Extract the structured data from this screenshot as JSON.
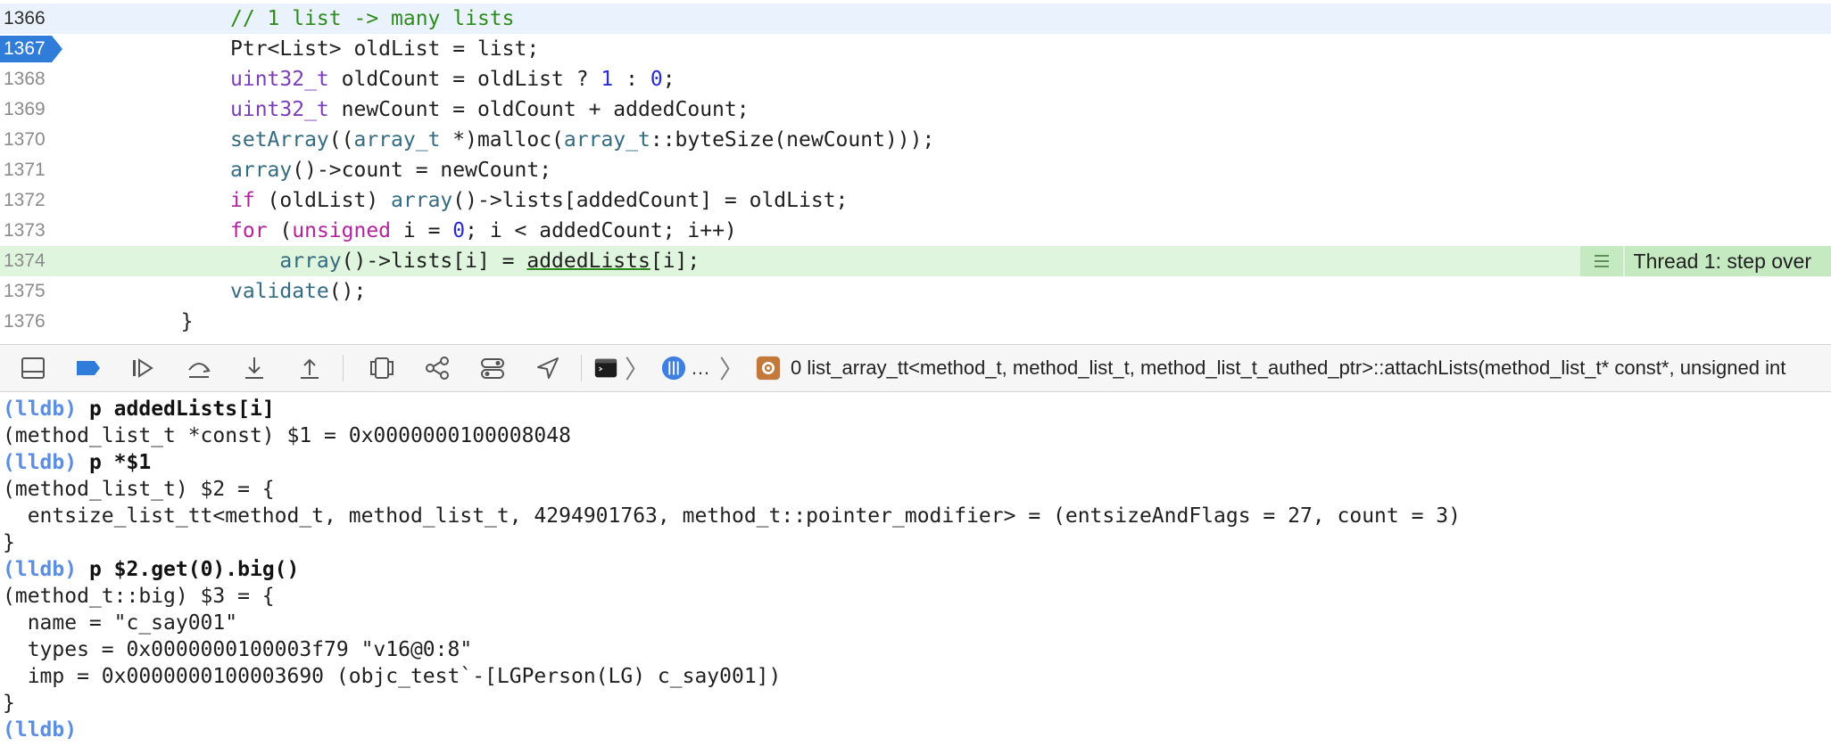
{
  "editor": {
    "lines": [
      {
        "num": "1366",
        "state": "current",
        "indent": 10,
        "tokens": [
          {
            "t": "// 1 list -> many lists",
            "c": "cm"
          }
        ]
      },
      {
        "num": "1367",
        "state": "pc",
        "indent": 10,
        "tokens": [
          {
            "t": "Ptr<List> oldList = list;",
            "c": ""
          }
        ]
      },
      {
        "num": "1368",
        "state": "",
        "indent": 10,
        "tokens": [
          {
            "t": "uint32_t",
            "c": "ty"
          },
          {
            "t": " oldCount = oldList ? ",
            "c": ""
          },
          {
            "t": "1",
            "c": "num"
          },
          {
            "t": " : ",
            "c": ""
          },
          {
            "t": "0",
            "c": "num"
          },
          {
            "t": ";",
            "c": ""
          }
        ]
      },
      {
        "num": "1369",
        "state": "",
        "indent": 10,
        "tokens": [
          {
            "t": "uint32_t",
            "c": "ty"
          },
          {
            "t": " newCount = oldCount + addedCount;",
            "c": ""
          }
        ]
      },
      {
        "num": "1370",
        "state": "",
        "indent": 10,
        "tokens": [
          {
            "t": "setArray",
            "c": "fn"
          },
          {
            "t": "((",
            "c": ""
          },
          {
            "t": "array_t",
            "c": "fn"
          },
          {
            "t": " *)malloc(",
            "c": ""
          },
          {
            "t": "array_t",
            "c": "fn"
          },
          {
            "t": "::byteSize(newCount)));",
            "c": ""
          }
        ]
      },
      {
        "num": "1371",
        "state": "",
        "indent": 10,
        "tokens": [
          {
            "t": "array",
            "c": "fn"
          },
          {
            "t": "()->count = newCount;",
            "c": ""
          }
        ]
      },
      {
        "num": "1372",
        "state": "",
        "indent": 10,
        "tokens": [
          {
            "t": "if",
            "c": "kw"
          },
          {
            "t": " (oldList) ",
            "c": ""
          },
          {
            "t": "array",
            "c": "fn"
          },
          {
            "t": "()->lists[addedCount] = oldList;",
            "c": ""
          }
        ]
      },
      {
        "num": "1373",
        "state": "",
        "indent": 10,
        "tokens": [
          {
            "t": "for",
            "c": "kw"
          },
          {
            "t": " (",
            "c": ""
          },
          {
            "t": "unsigned",
            "c": "kw"
          },
          {
            "t": " i = ",
            "c": ""
          },
          {
            "t": "0",
            "c": "num"
          },
          {
            "t": "; i < addedCount; i++)",
            "c": ""
          }
        ]
      },
      {
        "num": "1374",
        "state": "stepped",
        "indent": 14,
        "tokens": [
          {
            "t": "array",
            "c": "fn"
          },
          {
            "t": "()->lists[i] = ",
            "c": ""
          },
          {
            "t": "addedLists",
            "c": "ul"
          },
          {
            "t": "[i];",
            "c": ""
          }
        ]
      },
      {
        "num": "1375",
        "state": "",
        "indent": 10,
        "tokens": [
          {
            "t": "validate",
            "c": "fn"
          },
          {
            "t": "();",
            "c": ""
          }
        ]
      },
      {
        "num": "1376",
        "state": "",
        "indent": 6,
        "tokens": [
          {
            "t": "}",
            "c": ""
          }
        ]
      }
    ],
    "annotation": {
      "text": "Thread 1: step over",
      "line": "1374"
    }
  },
  "debugbar": {
    "buttons": [
      {
        "name": "hide-debug-area-icon"
      },
      {
        "name": "breakpoints-toggle-icon"
      },
      {
        "name": "continue-icon"
      },
      {
        "name": "step-over-icon"
      },
      {
        "name": "step-into-icon"
      },
      {
        "name": "step-out-icon"
      }
    ],
    "buttons2": [
      {
        "name": "view-hierarchy-icon"
      },
      {
        "name": "memory-graph-icon"
      },
      {
        "name": "environment-overrides-icon"
      },
      {
        "name": "simulate-location-icon"
      }
    ],
    "ellipsis": "…",
    "frame_label": "0 list_array_tt<method_t, method_list_t, method_list_t_authed_ptr>::attachLists(method_list_t* const*, unsigned int"
  },
  "console": {
    "lines": [
      {
        "prompt": "(lldb)",
        "cmd": "p addedLists[i]"
      },
      {
        "text": "(method_list_t *const) $1 = 0x0000000100008048"
      },
      {
        "prompt": "(lldb)",
        "cmd": "p *$1"
      },
      {
        "text": "(method_list_t) $2 = {"
      },
      {
        "text": "  entsize_list_tt<method_t, method_list_t, 4294901763, method_t::pointer_modifier> = (entsizeAndFlags = 27, count = 3)"
      },
      {
        "text": "}"
      },
      {
        "prompt": "(lldb)",
        "cmd": "p $2.get(0).big()"
      },
      {
        "text": "(method_t::big) $3 = {"
      },
      {
        "text": "  name = \"c_say001\""
      },
      {
        "text": "  types = 0x0000000100003f79 \"v16@0:8\""
      },
      {
        "text": "  imp = 0x0000000100003690 (objc_test`-[LGPerson(LG) c_say001])"
      },
      {
        "text": "}"
      },
      {
        "prompt": "(lldb)",
        "cmd": ""
      }
    ]
  },
  "colors": {
    "accent": "#2f7dd9",
    "prompt": "#5b8de0",
    "step_highlight": "#e0f5de",
    "current_line": "#eaf2fe"
  }
}
